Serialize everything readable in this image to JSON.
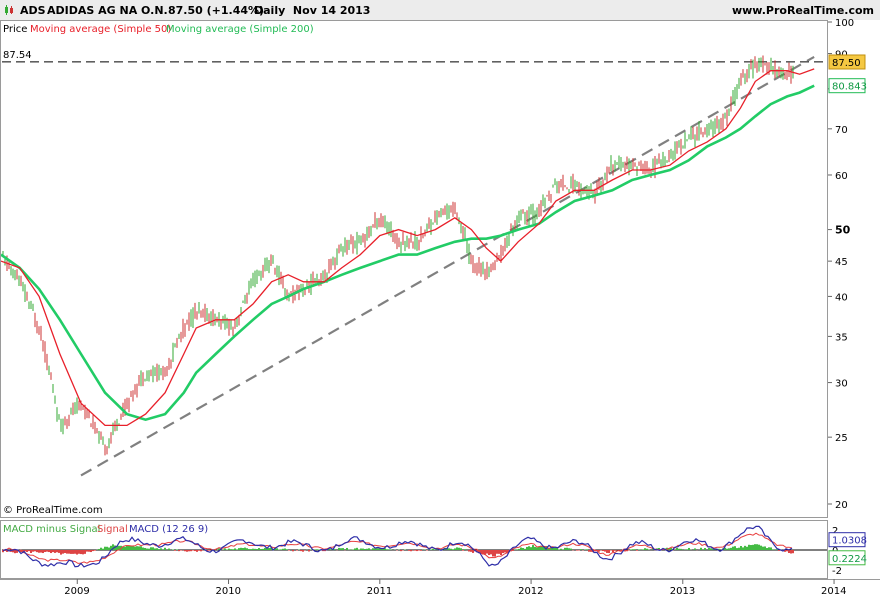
{
  "header": {
    "symbol": "ADS",
    "name": "ADIDAS AG NA O.N.",
    "price_change": "87.50 (+1.44%)",
    "period_date": "Daily  Nov 14 2013",
    "site": "www.ProRealTime.com"
  },
  "legend": {
    "price": "Price",
    "ma50": "Moving average (Simple 50)",
    "ma200": "Moving average (Simple 200)",
    "macd_hist": "MACD minus Signal",
    "macd_signal": "Signal",
    "macd_line": "MACD (12 26 9)"
  },
  "watermark": "© ProRealTime.com",
  "colors": {
    "price_up": "#33aa33",
    "price_down": "#cc3333",
    "ma50": "#e8202a",
    "ma200": "#22cc66",
    "macd": "#2e2ea8",
    "signal": "#e84040",
    "hist_pos": "#44bb44",
    "hist_neg": "#dd4444",
    "trendline": "#808080",
    "ref_line": "#000000"
  },
  "chart_data": [
    {
      "type": "line",
      "title": "",
      "scale": "log",
      "x": [
        "2008-07-01",
        "2008-08-15",
        "2008-10-01",
        "2008-11-20",
        "2009-01-10",
        "2009-03-09",
        "2009-05-01",
        "2009-06-15",
        "2009-08-01",
        "2009-09-15",
        "2009-10-15",
        "2009-12-01",
        "2010-01-15",
        "2010-03-01",
        "2010-04-15",
        "2010-05-25",
        "2010-07-01",
        "2010-08-20",
        "2010-10-01",
        "2010-11-15",
        "2011-01-01",
        "2011-02-15",
        "2011-04-01",
        "2011-05-15",
        "2011-07-01",
        "2011-08-10",
        "2011-09-15",
        "2011-10-20",
        "2011-12-01",
        "2012-01-20",
        "2012-03-01",
        "2012-04-15",
        "2012-06-01",
        "2012-07-15",
        "2012-09-01",
        "2012-10-15",
        "2012-12-01",
        "2013-01-15",
        "2013-03-01",
        "2013-04-15",
        "2013-05-20",
        "2013-06-25",
        "2013-08-01",
        "2013-09-10",
        "2013-10-10",
        "2013-11-14"
      ],
      "series": [
        {
          "name": "Price",
          "values": [
            46,
            42,
            36,
            26,
            28,
            24,
            28,
            31,
            31,
            36,
            38,
            37,
            36,
            42,
            45,
            40,
            41,
            43,
            47,
            48,
            52,
            48,
            48,
            52,
            54,
            45,
            43,
            46,
            52,
            53,
            58,
            58,
            56,
            62,
            62,
            61,
            64,
            68,
            70,
            72,
            82,
            87,
            86,
            84,
            86,
            87.5
          ]
        },
        {
          "name": "Moving average (Simple 50)",
          "values": [
            45,
            44,
            40,
            33,
            28,
            26,
            26,
            27,
            29,
            33,
            36,
            37,
            37,
            39,
            42,
            43,
            42,
            42,
            44,
            46,
            49,
            50,
            49,
            50,
            52,
            50,
            47,
            45,
            48,
            51,
            55,
            57,
            57,
            59,
            61,
            61,
            62,
            65,
            67,
            70,
            75,
            82,
            85,
            85,
            84,
            85.5
          ]
        },
        {
          "name": "Moving average (Simple 200)",
          "values": [
            46,
            44,
            41,
            37,
            33,
            29,
            27,
            26.5,
            27,
            29,
            31,
            33,
            35,
            37,
            39,
            40,
            41,
            42,
            43,
            44,
            45,
            46,
            46,
            47,
            48,
            48.5,
            48.5,
            49,
            50,
            51,
            53,
            55,
            56,
            57,
            59,
            60,
            61,
            63,
            66,
            68,
            70,
            73,
            76,
            78,
            79,
            80.84
          ]
        },
        {
          "name": "Support trend",
          "values": [
            null,
            null,
            null,
            null,
            22,
            null,
            null,
            null,
            null,
            null,
            null,
            null,
            null,
            null,
            null,
            null,
            null,
            null,
            null,
            null,
            null,
            null,
            null,
            null,
            null,
            null,
            null,
            null,
            null,
            null,
            null,
            null,
            null,
            null,
            null,
            null,
            null,
            null,
            null,
            null,
            null,
            null,
            null,
            null,
            null,
            89
          ]
        }
      ],
      "reference_line": {
        "label": "87.54",
        "value": 87.54
      },
      "last_labels": [
        "87.50",
        "80.843"
      ],
      "yticks": [
        "20",
        "25",
        "30",
        "35",
        "40",
        "45",
        "50",
        "60",
        "70",
        "80",
        "90",
        "100"
      ],
      "ylim": [
        20,
        100
      ]
    },
    {
      "type": "bar",
      "title": "MACD (12 26 9)",
      "x": [
        "2008-07",
        "2008-10",
        "2009-01",
        "2009-04",
        "2009-07",
        "2009-10",
        "2010-01",
        "2010-04",
        "2010-07",
        "2010-10",
        "2011-01",
        "2011-04",
        "2011-07",
        "2011-10",
        "2012-01",
        "2012-04",
        "2012-07",
        "2012-10",
        "2013-01",
        "2013-04",
        "2013-07",
        "2013-10",
        "2013-11"
      ],
      "series": [
        {
          "name": "MACD",
          "values": [
            -0.2,
            -0.8,
            -2.0,
            0.3,
            1.0,
            0.5,
            0.3,
            0.8,
            0.2,
            0.6,
            0.8,
            0.3,
            0.7,
            -1.2,
            0.8,
            0.6,
            -0.4,
            0.4,
            0.5,
            0.6,
            2.0,
            -0.3,
            1.0308
          ]
        },
        {
          "name": "Signal",
          "values": [
            0,
            -0.6,
            -1.5,
            -0.2,
            0.8,
            0.6,
            0.2,
            0.6,
            0.3,
            0.5,
            0.7,
            0.4,
            0.5,
            -0.6,
            0.4,
            0.5,
            -0.2,
            0.3,
            0.4,
            0.5,
            1.5,
            0.1,
            0.8084
          ]
        },
        {
          "name": "MACD minus Signal",
          "values": [
            -0.2,
            -0.2,
            -0.5,
            0.5,
            0.2,
            -0.1,
            0.1,
            0.2,
            -0.1,
            0.1,
            0.1,
            -0.1,
            0.2,
            -0.6,
            0.4,
            0.1,
            -0.2,
            0.1,
            0.1,
            0.1,
            0.5,
            -0.4,
            0.2224
          ]
        }
      ],
      "last_labels": [
        "1.0308",
        "0.2224"
      ],
      "yticks": [
        "2",
        "0",
        "-2"
      ],
      "ylim": [
        -2.6,
        2.6
      ]
    }
  ],
  "xaxis": {
    "ticks": [
      "2009",
      "2010",
      "2011",
      "2012",
      "2013",
      "2014"
    ]
  }
}
